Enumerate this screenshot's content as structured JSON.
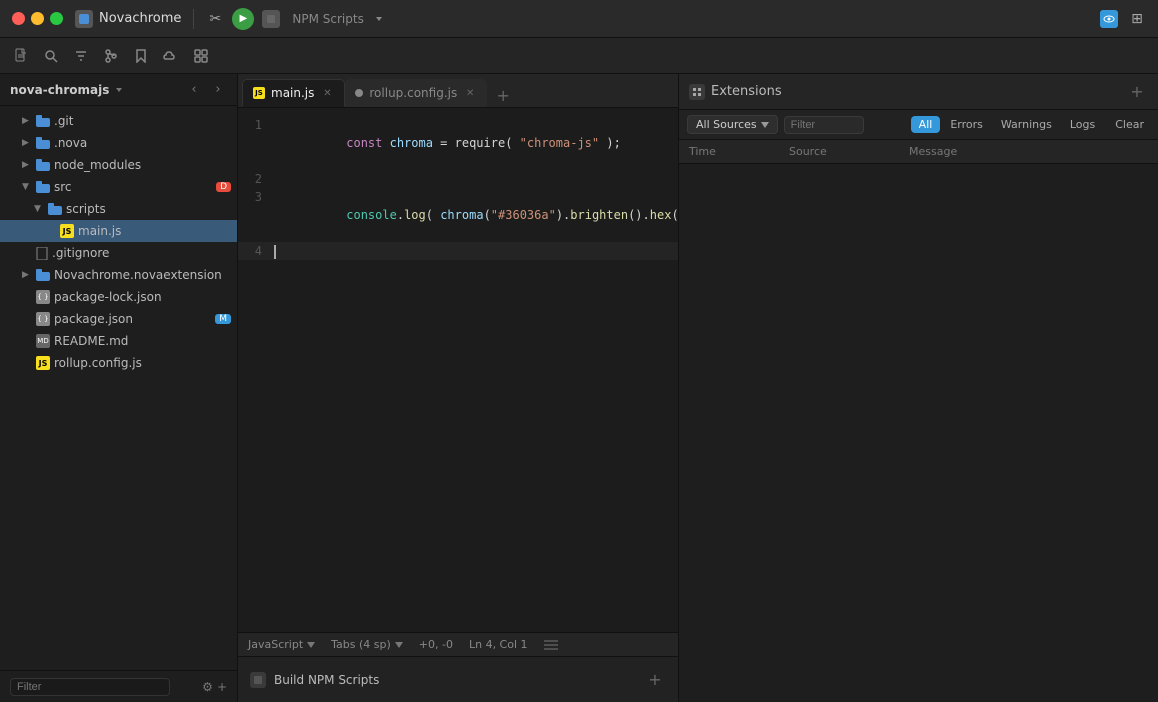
{
  "titleBar": {
    "appName": "Novachrome",
    "taskName": "NPM Scripts",
    "runTooltip": "Run",
    "stopTooltip": "Stop"
  },
  "toolbar": {
    "newFile": "New File",
    "search": "Search",
    "listFilter": "List Filter",
    "branches": "Branches",
    "bookmark": "Bookmark",
    "cloud": "Cloud",
    "grid": "Grid"
  },
  "sidebar": {
    "projectName": "nova-chromajs",
    "filterPlaceholder": "Filter",
    "items": [
      {
        "label": ".git",
        "type": "folder",
        "indent": 1,
        "expanded": false
      },
      {
        "label": ".nova",
        "type": "folder",
        "indent": 1,
        "expanded": false
      },
      {
        "label": "node_modules",
        "type": "folder",
        "indent": 1,
        "expanded": false
      },
      {
        "label": "src",
        "type": "folder",
        "indent": 1,
        "expanded": true,
        "badge": "D"
      },
      {
        "label": "scripts",
        "type": "folder",
        "indent": 2,
        "expanded": true
      },
      {
        "label": "main.js",
        "type": "jsfile",
        "indent": 3,
        "active": true
      },
      {
        "label": ".gitignore",
        "type": "file",
        "indent": 1
      },
      {
        "label": "Novachrome.novaextension",
        "type": "folder",
        "indent": 1,
        "expanded": false
      },
      {
        "label": "package-lock.json",
        "type": "jsonfile",
        "indent": 1
      },
      {
        "label": "package.json",
        "type": "jsonfile",
        "indent": 1,
        "badge": "M"
      },
      {
        "label": "README.md",
        "type": "mdfile",
        "indent": 1
      },
      {
        "label": "rollup.config.js",
        "type": "jsfile",
        "indent": 1
      }
    ]
  },
  "editor": {
    "tabs": [
      {
        "label": "main.js",
        "active": true,
        "dirty": false
      },
      {
        "label": "rollup.config.js",
        "active": false,
        "dirty": false
      }
    ],
    "lines": [
      {
        "number": 1,
        "parts": [
          {
            "text": "const",
            "class": "kw"
          },
          {
            "text": " chroma ",
            "class": "var"
          },
          {
            "text": "=",
            "class": "op"
          },
          {
            "text": " require(",
            "class": "punc"
          },
          {
            "text": " \"chroma-js\"",
            "class": "str"
          },
          {
            "text": " );",
            "class": "punc"
          }
        ]
      },
      {
        "number": 2,
        "parts": []
      },
      {
        "number": 3,
        "parts": [
          {
            "text": "console",
            "class": "obj"
          },
          {
            "text": ".",
            "class": "punc"
          },
          {
            "text": "log",
            "class": "method"
          },
          {
            "text": "( ",
            "class": "punc"
          },
          {
            "text": "chroma",
            "class": "var"
          },
          {
            "text": "(",
            "class": "punc"
          },
          {
            "text": "\"#36036a\"",
            "class": "str"
          },
          {
            "text": ").",
            "class": "punc"
          },
          {
            "text": "brighten",
            "class": "method"
          },
          {
            "text": "().",
            "class": "punc"
          },
          {
            "text": "hex",
            "class": "method"
          },
          {
            "text": "() );",
            "class": "punc"
          }
        ]
      },
      {
        "number": 4,
        "parts": [],
        "cursor": true
      }
    ],
    "language": "JavaScript",
    "indentation": "Tabs (4 sp)",
    "diff": "+0, -0",
    "position": "Ln 4, Col 1"
  },
  "buildPanel": {
    "name": "Build NPM Scripts"
  },
  "console": {
    "title": "Extensions",
    "allSourcesLabel": "All Sources",
    "filterPlaceholder": "Filter",
    "tabs": [
      {
        "label": "All",
        "active": true
      },
      {
        "label": "Errors",
        "active": false
      },
      {
        "label": "Warnings",
        "active": false
      },
      {
        "label": "Logs",
        "active": false
      }
    ],
    "clearLabel": "Clear",
    "columns": {
      "time": "Time",
      "source": "Source",
      "message": "Message"
    }
  }
}
